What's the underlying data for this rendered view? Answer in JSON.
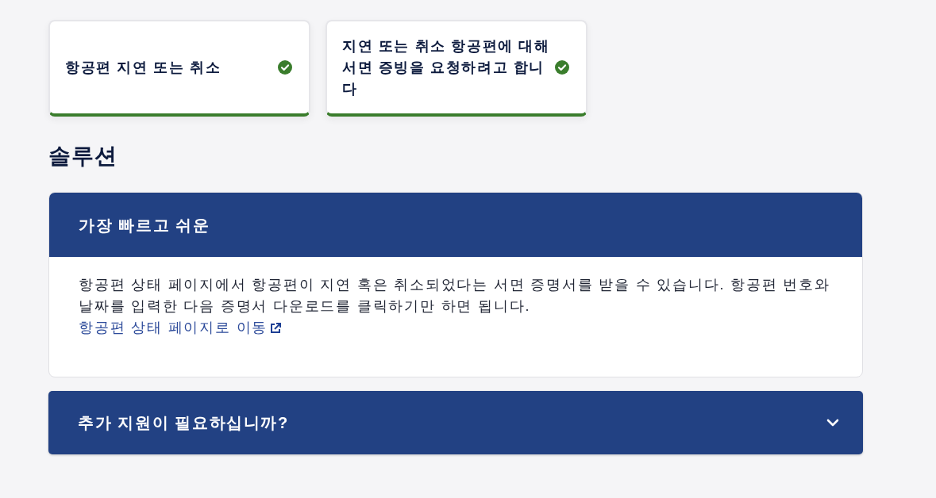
{
  "steps": [
    {
      "label": "항공편 지연 또는 취소",
      "selected": true
    },
    {
      "label": "지연 또는 취소 항공편에 대해 서면 증빙을 요청하려고 합니다",
      "selected": true
    }
  ],
  "heading": "솔루션",
  "solution": {
    "title": "가장 빠르고 쉬운",
    "body": "항공편 상태 페이지에서 항공편이 지연 혹은 취소되었다는 서면 증명서를 받을 수 있습니다. 항공편 번호와 날짜를 입력한 다음 증명서 다운로드를 클릭하기만 하면 됩니다.",
    "link": "항공편 상태 페이지로 이동"
  },
  "help": {
    "title": "추가 지원이 필요하십니까?",
    "expanded": false
  }
}
